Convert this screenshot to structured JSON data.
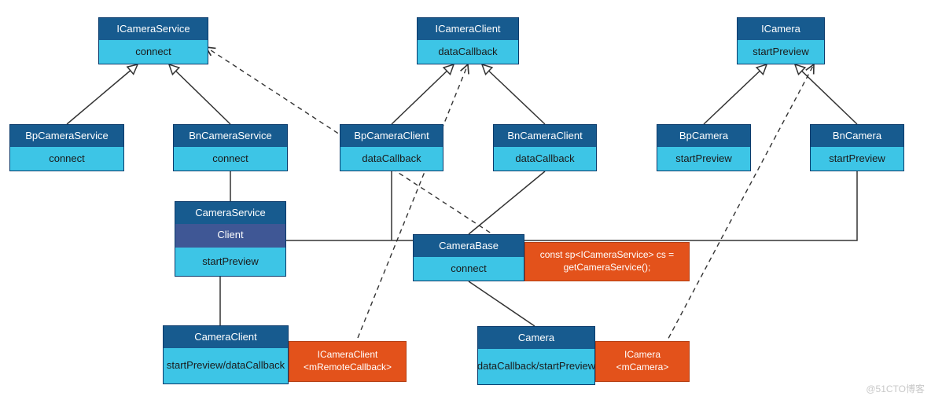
{
  "boxes": {
    "iCameraService": {
      "title": "ICameraService",
      "body": "connect"
    },
    "bpCameraService": {
      "title": "BpCameraService",
      "body": "connect"
    },
    "bnCameraService": {
      "title": "BnCameraService",
      "body": "connect"
    },
    "iCameraClient": {
      "title": "ICameraClient",
      "body": "dataCallback"
    },
    "bpCameraClient": {
      "title": "BpCameraClient",
      "body": "dataCallback"
    },
    "bnCameraClient": {
      "title": "BnCameraClient",
      "body": "dataCallback"
    },
    "iCamera": {
      "title": "ICamera",
      "body": "startPreview"
    },
    "bpCamera": {
      "title": "BpCamera",
      "body": "startPreview"
    },
    "bnCamera": {
      "title": "BnCamera",
      "body": "startPreview"
    },
    "cameraService": {
      "title": "CameraService",
      "client": "Client",
      "body": "startPreview"
    },
    "cameraBase": {
      "title": "CameraBase",
      "body": "connect"
    },
    "cameraClient": {
      "title": "CameraClient",
      "body": "startPreview/dataCallback"
    },
    "camera": {
      "title": "Camera",
      "body": "dataCallback/startPreview"
    }
  },
  "notes": {
    "cameraBaseNote": "const sp<ICameraService> cs =\ngetCameraService();",
    "cameraClientNote": "ICameraClient\n<mRemoteCallback>",
    "cameraNote": "ICamera\n<mCamera>"
  },
  "watermark": "@51CTO博客",
  "colors": {
    "headerBg": "#175b8f",
    "bodyBg": "#3dc5e6",
    "slateBg": "#3f5795",
    "noteBg": "#e3521b",
    "border": "#0a3a6b"
  },
  "chart_data": {
    "type": "table",
    "description": "UML-style class/interface inheritance & dependency diagram (Android Camera IPC architecture).",
    "nodes": [
      {
        "id": "ICameraService",
        "methods": [
          "connect"
        ]
      },
      {
        "id": "BpCameraService",
        "methods": [
          "connect"
        ]
      },
      {
        "id": "BnCameraService",
        "methods": [
          "connect"
        ]
      },
      {
        "id": "ICameraClient",
        "methods": [
          "dataCallback"
        ]
      },
      {
        "id": "BpCameraClient",
        "methods": [
          "dataCallback"
        ]
      },
      {
        "id": "BnCameraClient",
        "methods": [
          "dataCallback"
        ]
      },
      {
        "id": "ICamera",
        "methods": [
          "startPreview"
        ]
      },
      {
        "id": "BpCamera",
        "methods": [
          "startPreview"
        ]
      },
      {
        "id": "BnCamera",
        "methods": [
          "startPreview"
        ]
      },
      {
        "id": "CameraService",
        "inner": "Client",
        "methods": [
          "startPreview"
        ]
      },
      {
        "id": "CameraBase",
        "methods": [
          "connect"
        ]
      },
      {
        "id": "CameraClient",
        "methods": [
          "startPreview",
          "dataCallback"
        ]
      },
      {
        "id": "Camera",
        "methods": [
          "dataCallback",
          "startPreview"
        ]
      }
    ],
    "inheritance_edges": [
      {
        "from": "BpCameraService",
        "to": "ICameraService"
      },
      {
        "from": "BnCameraService",
        "to": "ICameraService"
      },
      {
        "from": "BpCameraClient",
        "to": "ICameraClient"
      },
      {
        "from": "BnCameraClient",
        "to": "ICameraClient"
      },
      {
        "from": "BpCamera",
        "to": "ICamera"
      },
      {
        "from": "BnCamera",
        "to": "ICamera"
      },
      {
        "from": "CameraService",
        "to": "BnCameraService"
      },
      {
        "from": "CameraClient",
        "to": "CameraService"
      },
      {
        "from": "CameraBase",
        "to": "BnCameraClient"
      },
      {
        "from": "Camera",
        "to": "CameraBase"
      }
    ],
    "association_edges": [
      {
        "from": "CameraService.Client",
        "to": "BnCamera"
      },
      {
        "from": "CameraService.Client",
        "to": "BpCameraClient"
      }
    ],
    "dependency_edges": [
      {
        "from": "CameraBase",
        "to": "ICameraService",
        "note": "const sp<ICameraService> cs = getCameraService();"
      },
      {
        "from": "CameraClient",
        "to": "ICameraClient",
        "note": "ICameraClient <mRemoteCallback>"
      },
      {
        "from": "Camera",
        "to": "ICamera",
        "note": "ICamera <mCamera>"
      }
    ]
  }
}
